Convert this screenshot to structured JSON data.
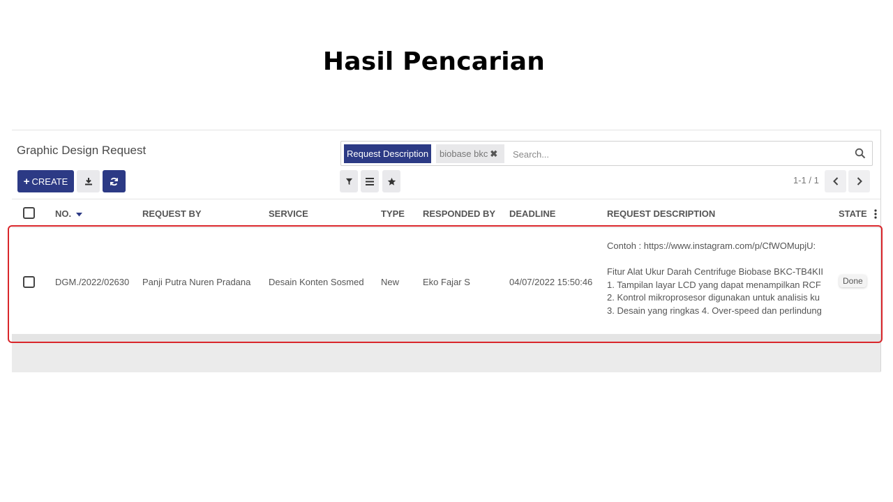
{
  "headline": "Hasil Pencarian",
  "app": {
    "title": "Graphic Design Request",
    "create_label": "CREATE"
  },
  "search": {
    "facet_label": "Request Description",
    "facet_value": "biobase bkc",
    "placeholder": "Search..."
  },
  "pager": {
    "text": "1-1 / 1"
  },
  "table": {
    "headers": {
      "no": "NO.",
      "request_by": "REQUEST BY",
      "service": "SERVICE",
      "type": "TYPE",
      "responded_by": "RESPONDED BY",
      "deadline": "DEADLINE",
      "request_description": "REQUEST DESCRIPTION",
      "state": "STATE"
    },
    "rows": [
      {
        "no": "DGM./2022/02630",
        "request_by": "Panji Putra Nuren Pradana",
        "service": "Desain Konten Sosmed",
        "type": "New",
        "responded_by": "Eko Fajar S",
        "deadline": "04/07/2022 15:50:46",
        "description_lines": [
          "Contoh : https://www.instagram.com/p/CfWOMupjU:",
          "",
          "Fitur Alat Ukur Darah Centrifuge Biobase BKC-TB4KII",
          "1. Tampilan layar LCD yang dapat menampilkan RCF",
          "2. Kontrol mikroprosesor digunakan untuk analisis ku",
          "3. Desain yang ringkas 4. Over-speed dan perlindung"
        ],
        "state": "Done"
      }
    ]
  },
  "colors": {
    "primary": "#2c3a85",
    "highlight": "#d9262b"
  }
}
